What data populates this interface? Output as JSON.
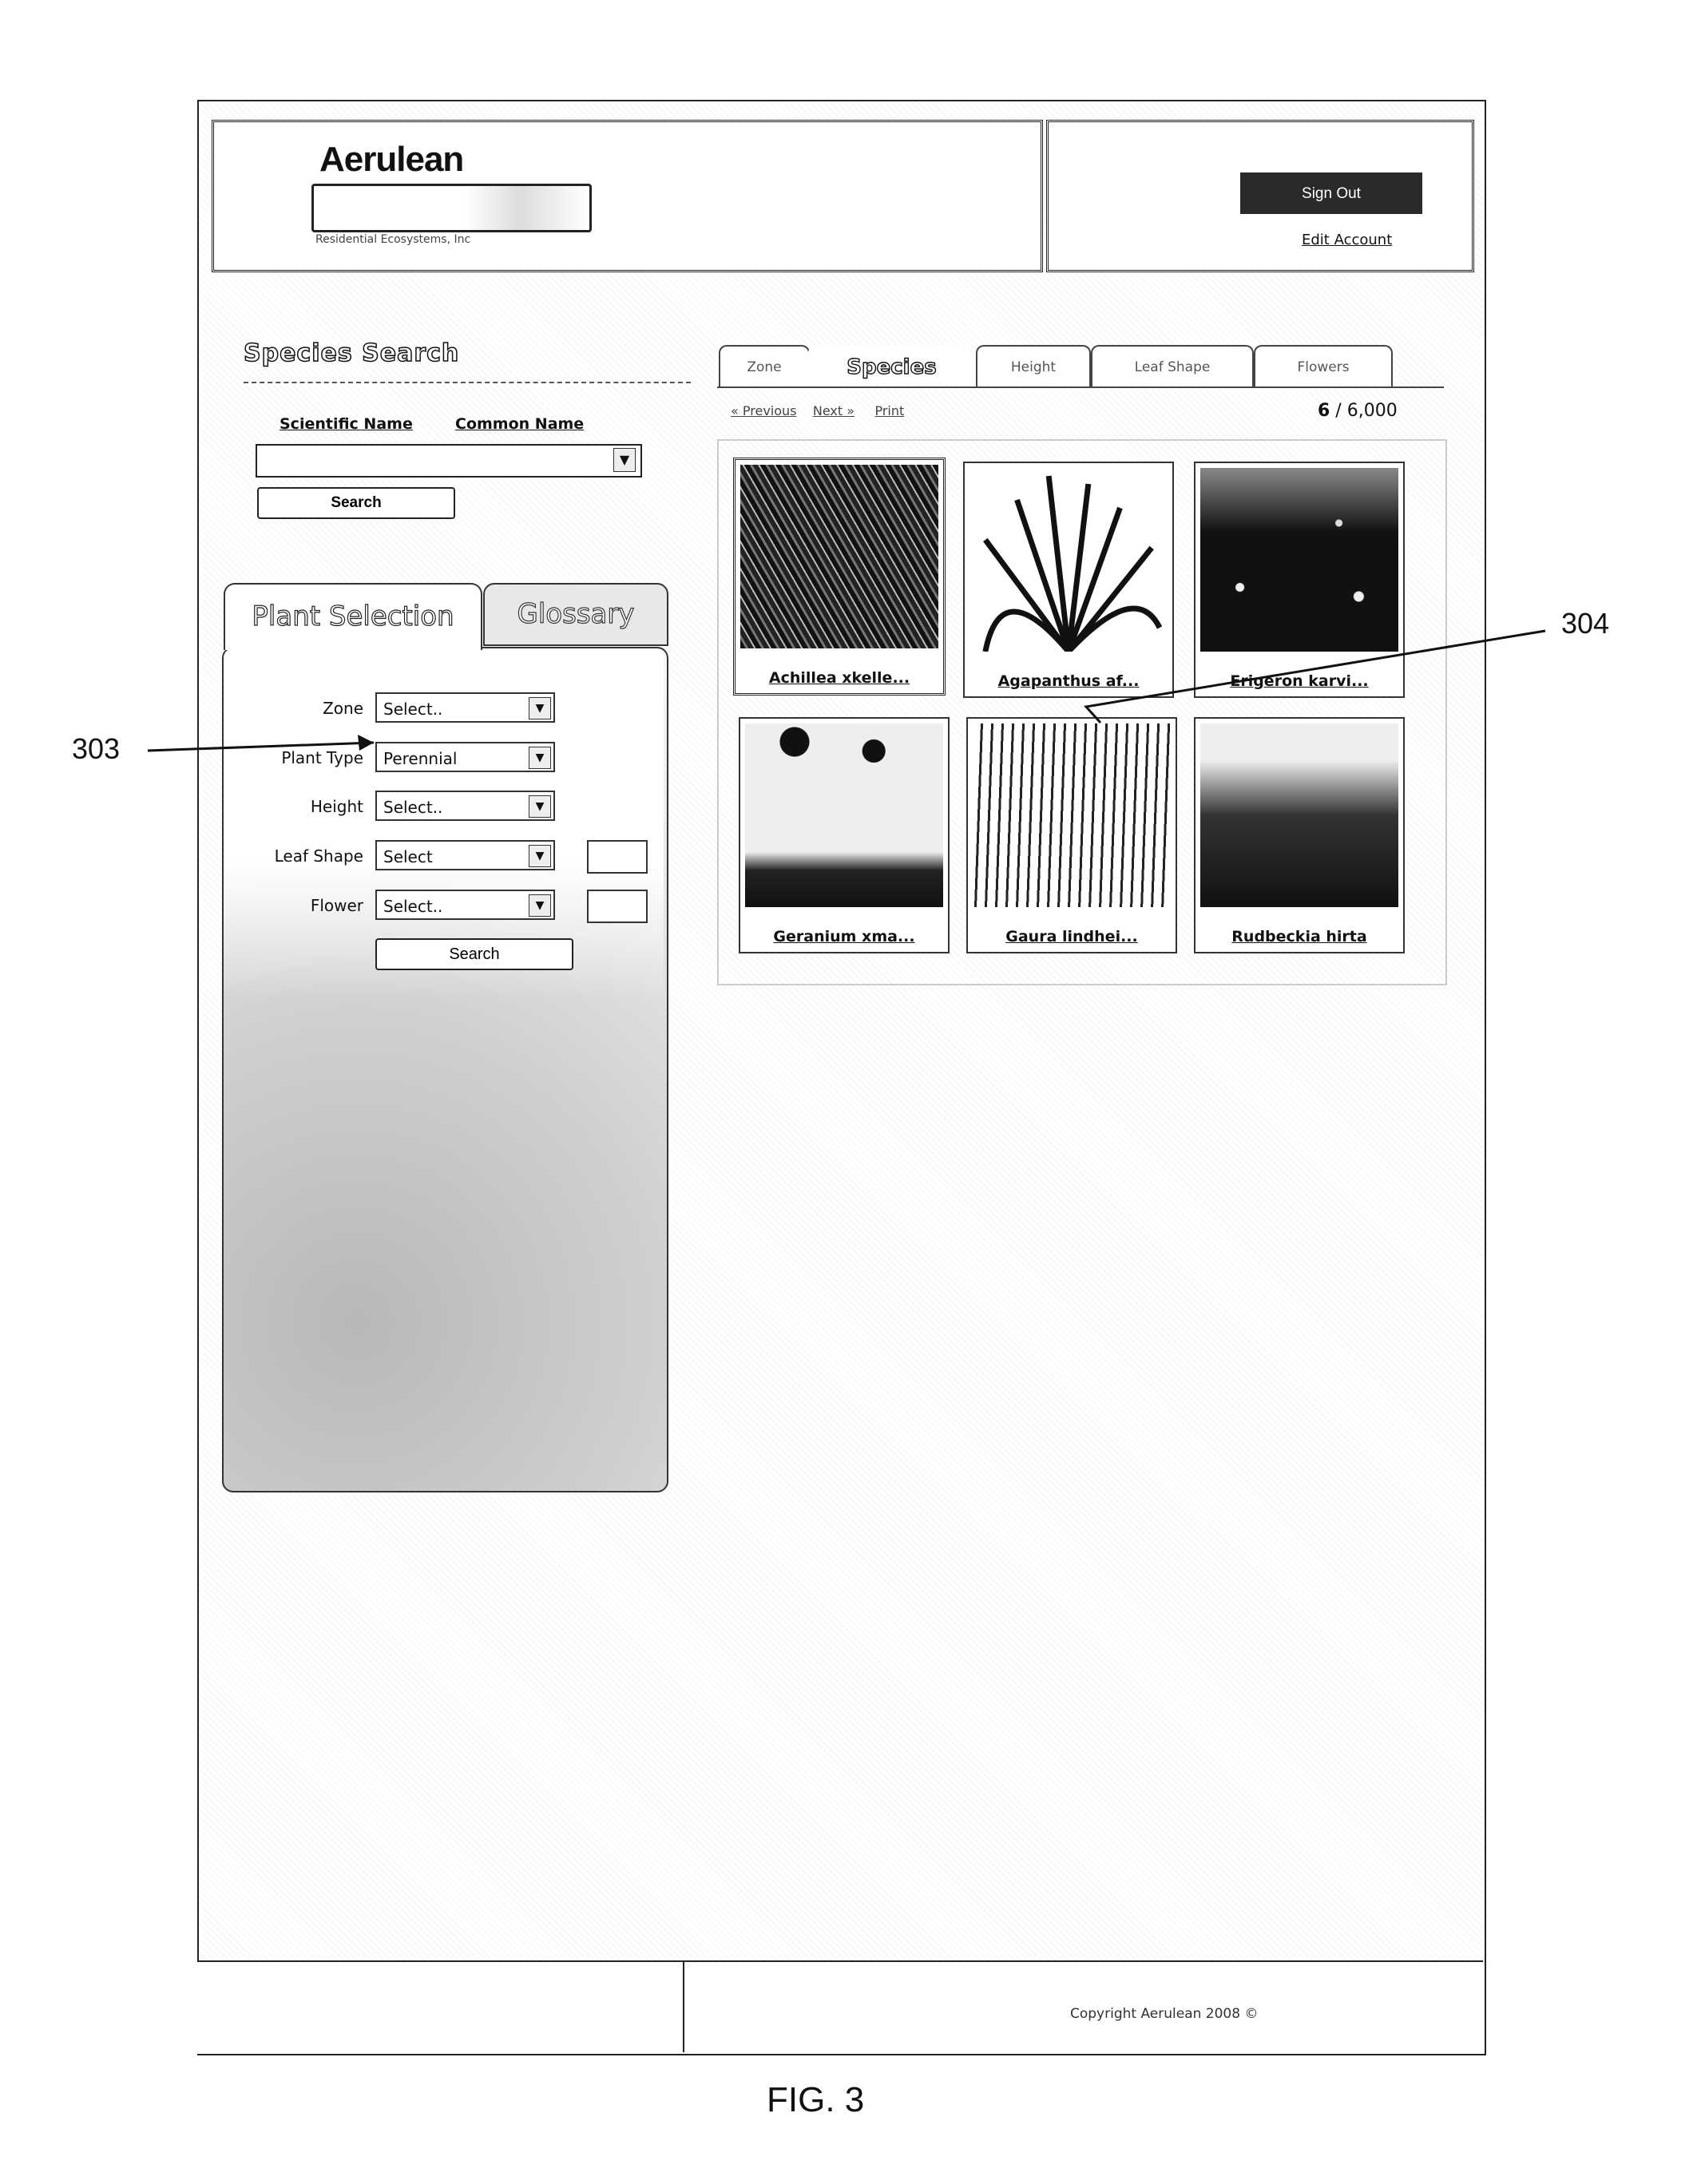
{
  "header": {
    "logo": "Aerulean",
    "logo_subtitle": "Residential Ecosystems, Inc",
    "sign_out": "Sign Out",
    "edit_account": "Edit Account"
  },
  "species_search": {
    "title": "Species Search",
    "scientific_name_link": "Scientific Name",
    "common_name_link": "Common Name",
    "input_value": "",
    "search_button": "Search",
    "dropdown_icon": "chevron-down-icon"
  },
  "plant_selection": {
    "tabs": [
      {
        "label": "Plant Selection",
        "active": true
      },
      {
        "label": "Glossary",
        "active": false
      }
    ],
    "fields": [
      {
        "label": "Zone",
        "value": "Select..",
        "has_swatch": false
      },
      {
        "label": "Plant Type",
        "value": "Perennial",
        "has_swatch": false
      },
      {
        "label": "Height",
        "value": "Select..",
        "has_swatch": false
      },
      {
        "label": "Leaf Shape",
        "value": "Select",
        "has_swatch": true
      },
      {
        "label": "Flower",
        "value": "Select..",
        "has_swatch": true
      }
    ],
    "search_button": "Search"
  },
  "results": {
    "tabs": [
      {
        "label": "Zone",
        "active": false
      },
      {
        "label": "Species",
        "active": true
      },
      {
        "label": "Height",
        "active": false
      },
      {
        "label": "Leaf Shape",
        "active": false
      },
      {
        "label": "Flowers",
        "active": false
      }
    ],
    "breadcrumb": [
      "« Previous",
      "Next »",
      "Print"
    ],
    "count_shown": "6",
    "count_total": "6,000",
    "count_separator": " / ",
    "plants": [
      {
        "caption": "Achillea xkelle...",
        "selected": true
      },
      {
        "caption": "Agapanthus af...",
        "selected": false
      },
      {
        "caption": "Erigeron karvi...",
        "selected": false
      },
      {
        "caption": "Geranium xma...",
        "selected": false
      },
      {
        "caption": "Gaura lindhei...",
        "selected": false
      },
      {
        "caption": "Rudbeckia hirta",
        "selected": false
      }
    ]
  },
  "footer": {
    "copyright": "Copyright Aerulean 2008 ©"
  },
  "annotations": {
    "callout_303": "303",
    "callout_304": "304",
    "figure_label": "FIG. 3"
  }
}
